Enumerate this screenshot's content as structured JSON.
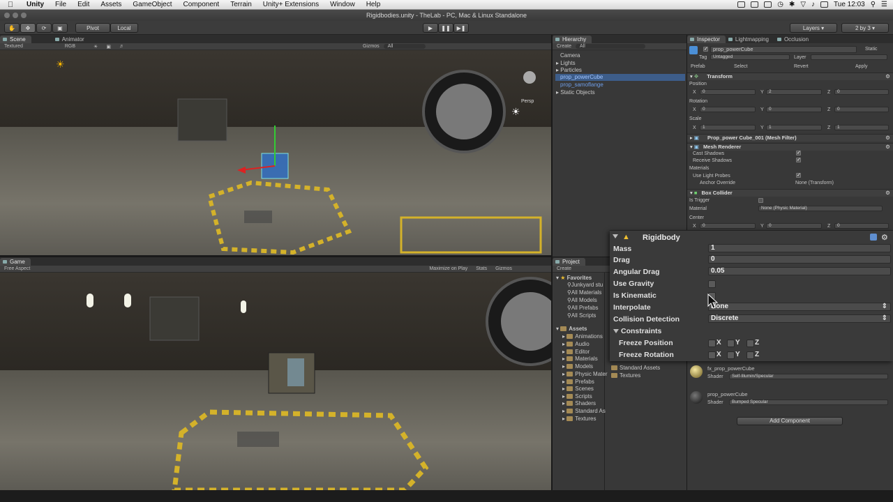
{
  "menubar": {
    "app": "Unity",
    "items": [
      "File",
      "Edit",
      "Assets",
      "GameObject",
      "Component",
      "Terrain",
      "Unity+ Extensions",
      "Window",
      "Help"
    ],
    "clock": "Tue 12:03"
  },
  "window": {
    "title": "Rigidbodies.unity - TheLab - PC, Mac & Linux Standalone"
  },
  "toolbar": {
    "pivot": "Pivot",
    "local": "Local",
    "layers": "Layers",
    "layout": "2 by 3"
  },
  "scene": {
    "tab": "Scene",
    "tab2": "Animator",
    "shading": "Textured",
    "render": "RGB",
    "gizmos": "Gizmos",
    "search": "All",
    "persp": "Persp"
  },
  "game": {
    "tab": "Game",
    "aspect": "Free Aspect",
    "maximize": "Maximize on Play",
    "stats": "Stats",
    "gizmos": "Gizmos"
  },
  "hierarchy": {
    "tab": "Hierarchy",
    "create": "Create",
    "search": "All",
    "items": [
      "Camera",
      "Lights",
      "Particles",
      "prop_powerCube",
      "prop_samoflange",
      "Static Objects"
    ]
  },
  "project": {
    "tab": "Project",
    "create": "Create",
    "favorites_label": "Favorites",
    "favorites": [
      "Junkyard stu",
      "All Materials",
      "All Models",
      "All Prefabs",
      "All Scripts"
    ],
    "assets_label": "Assets",
    "assets": [
      "Animations",
      "Audio",
      "Editor",
      "Materials",
      "Models",
      "Physic Mater",
      "Prefabs",
      "Scenes",
      "Scripts",
      "Shaders",
      "Standard As",
      "Textures"
    ],
    "right_items": [
      "Standard Assets",
      "Textures"
    ]
  },
  "inspector": {
    "tab": "Inspector",
    "tab2": "Lightmapping",
    "tab3": "Occlusion",
    "object_name": "prop_powerCube",
    "static": "Static",
    "tag_label": "Tag",
    "tag_value": "Untagged",
    "layer_label": "Layer",
    "prefab_label": "Prefab",
    "prefab_select": "Select",
    "prefab_revert": "Revert",
    "prefab_apply": "Apply",
    "transform": {
      "title": "Transform",
      "position_label": "Position",
      "rotation_label": "Rotation",
      "scale_label": "Scale",
      "position": [
        "0",
        "2",
        "0"
      ],
      "rotation": [
        "0",
        "0",
        "0"
      ],
      "scale": [
        "1",
        "1",
        "1"
      ]
    },
    "mesh_filter": "Prop_power Cube_001 (Mesh Filter)",
    "mesh_renderer": {
      "title": "Mesh Renderer",
      "cast_shadows": "Cast Shadows",
      "receive_shadows": "Receive Shadows",
      "materials": "Materials",
      "light_probes": "Use Light Probes",
      "anchor_override": "Anchor Override",
      "anchor_value": "None (Transform)"
    },
    "box_collider": {
      "title": "Box Collider",
      "is_trigger": "Is Trigger",
      "material": "Material",
      "material_value": "None (Physic Material)",
      "center": "Center",
      "center_values": [
        "0",
        "0",
        "0"
      ]
    },
    "materials_list": [
      {
        "name": "fx_prop_powerCube",
        "shader_label": "Shader",
        "shader": "Self-Illumin/Specular"
      },
      {
        "name": "prop_powerCube",
        "shader_label": "Shader",
        "shader": "Bumped Specular"
      }
    ],
    "add_component": "Add Component"
  },
  "rigidbody": {
    "title": "Rigidbody",
    "mass_label": "Mass",
    "mass": "1",
    "drag_label": "Drag",
    "drag": "0",
    "angular_drag_label": "Angular Drag",
    "angular_drag": "0.05",
    "use_gravity_label": "Use Gravity",
    "is_kinematic_label": "Is Kinematic",
    "interpolate_label": "Interpolate",
    "interpolate": "None",
    "collision_label": "Collision Detection",
    "collision": "Discrete",
    "constraints_label": "Constraints",
    "freeze_position_label": "Freeze Position",
    "freeze_rotation_label": "Freeze Rotation",
    "axes": [
      "X",
      "Y",
      "Z"
    ]
  },
  "axes_labels": [
    "X",
    "Y",
    "Z"
  ]
}
